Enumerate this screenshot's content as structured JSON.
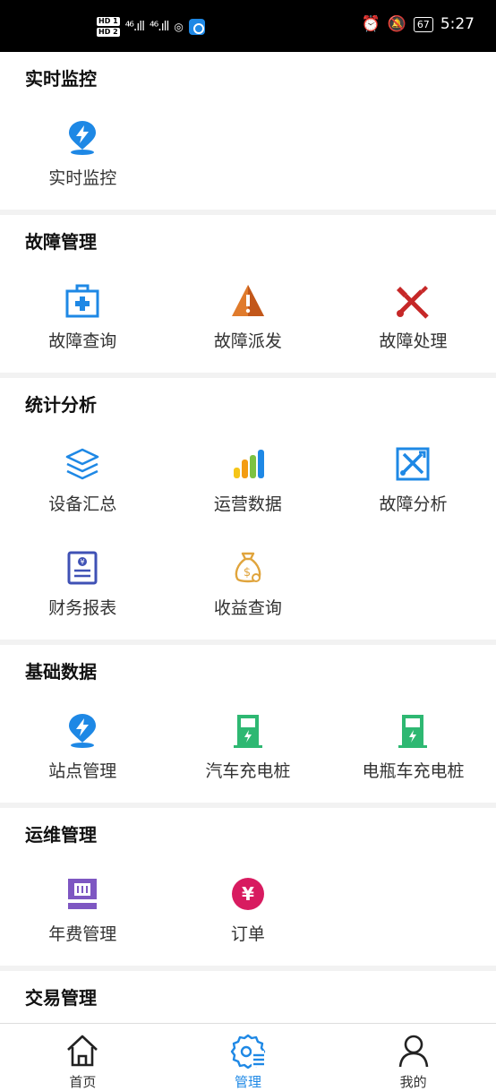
{
  "status_bar": {
    "hd1": "HD 1",
    "hd2": "HD 2",
    "sig1": "⁴⁶.ıll",
    "sig2": "⁴⁶.ıll",
    "battery": "67",
    "time": "5:27"
  },
  "sections": [
    {
      "title": "实时监控",
      "items": [
        {
          "label": "实时监控",
          "icon": "bolt-pin-icon"
        }
      ]
    },
    {
      "title": "故障管理",
      "items": [
        {
          "label": "故障查询",
          "icon": "first-aid-kit-icon"
        },
        {
          "label": "故障派发",
          "icon": "warning-triangle-icon"
        },
        {
          "label": "故障处理",
          "icon": "tools-icon"
        }
      ]
    },
    {
      "title": "统计分析",
      "items": [
        {
          "label": "设备汇总",
          "icon": "layers-icon"
        },
        {
          "label": "运营数据",
          "icon": "bar-chart-icon"
        },
        {
          "label": "故障分析",
          "icon": "wrench-box-icon"
        },
        {
          "label": "财务报表",
          "icon": "finance-report-icon"
        },
        {
          "label": "收益查询",
          "icon": "money-bag-icon"
        }
      ]
    },
    {
      "title": "基础数据",
      "items": [
        {
          "label": "站点管理",
          "icon": "bolt-pin-icon"
        },
        {
          "label": "汽车充电桩",
          "icon": "charging-pile-icon"
        },
        {
          "label": "电瓶车充电桩",
          "icon": "charging-pile-icon"
        }
      ]
    },
    {
      "title": "运维管理",
      "items": [
        {
          "label": "年费管理",
          "icon": "sim-card-icon"
        },
        {
          "label": "订单",
          "icon": "yuan-circle-icon"
        }
      ]
    },
    {
      "title": "交易管理",
      "items": []
    }
  ],
  "tabs": [
    {
      "label": "首页",
      "icon": "home-icon"
    },
    {
      "label": "管理",
      "icon": "settings-list-icon"
    },
    {
      "label": "我的",
      "icon": "user-icon"
    }
  ],
  "colors": {
    "accent": "#1e88e5"
  }
}
